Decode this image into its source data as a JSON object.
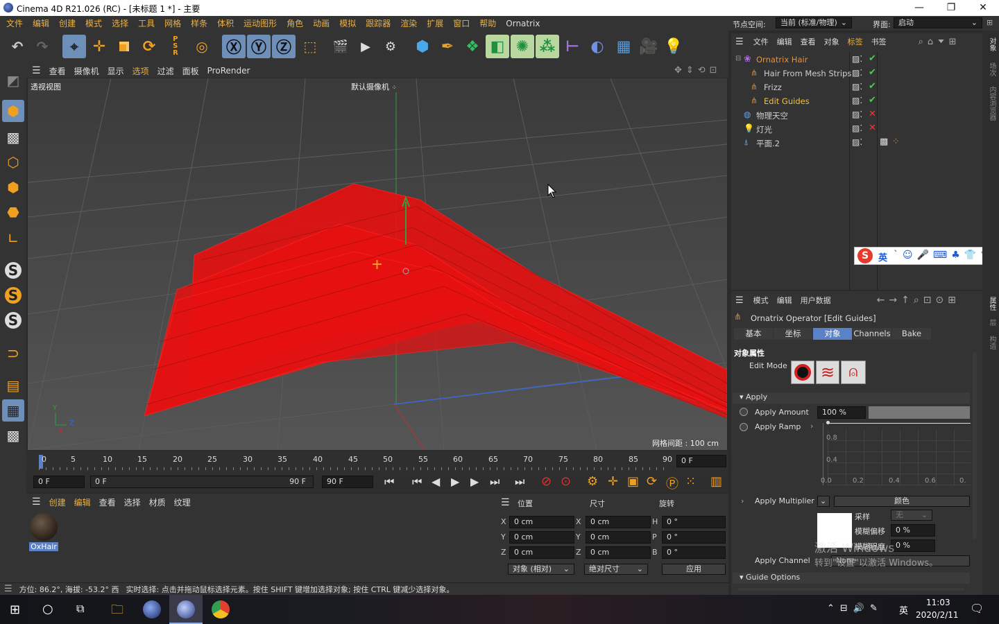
{
  "window": {
    "title": "Cinema 4D R21.026 (RC) - [未标题 1 *] - 主要",
    "min": "—",
    "max": "❐",
    "close": "✕"
  },
  "menubar": [
    "文件",
    "编辑",
    "创建",
    "模式",
    "选择",
    "工具",
    "网格",
    "样条",
    "体积",
    "运动图形",
    "角色",
    "动画",
    "模拟",
    "跟踪器",
    "渲染",
    "扩展",
    "窗口",
    "帮助",
    "Ornatrix"
  ],
  "nodebar": {
    "label": "节点空间:",
    "value": "当前 (标准/物理)",
    "layout_label": "界面:",
    "layout_value": "启动"
  },
  "viewport": {
    "menu": [
      "查看",
      "摄像机",
      "显示",
      "选项",
      "过滤",
      "面板",
      "ProRender"
    ],
    "view_name": "透视视图",
    "camera": "默认摄像机",
    "grid_info": "网格间距 : 100 cm",
    "axis_y": "Y",
    "axis_z": "Z",
    "axis_x": "X"
  },
  "timeline": {
    "ticks": [
      "0",
      "5",
      "10",
      "15",
      "20",
      "25",
      "30",
      "35",
      "40",
      "45",
      "50",
      "55",
      "60",
      "65",
      "70",
      "75",
      "80",
      "85",
      "90"
    ],
    "current_frame": "0 F",
    "start": "0 F",
    "range_start": "0 F",
    "range_end": "90 F",
    "end": "90 F"
  },
  "material_manager": {
    "menu": [
      "创建",
      "编辑",
      "查看",
      "选择",
      "材质",
      "纹理"
    ],
    "material_name": "OxHair"
  },
  "coordinates": {
    "headers": [
      "位置",
      "尺寸",
      "旋转"
    ],
    "rows": [
      {
        "a": "X",
        "av": "0 cm",
        "b": "X",
        "bv": "0 cm",
        "c": "H",
        "cv": "0 °"
      },
      {
        "a": "Y",
        "av": "0 cm",
        "b": "Y",
        "bv": "0 cm",
        "c": "P",
        "cv": "0 °"
      },
      {
        "a": "Z",
        "av": "0 cm",
        "b": "Z",
        "bv": "0 cm",
        "c": "B",
        "cv": "0 °"
      }
    ],
    "mode": "对象 (相对)",
    "size_mode": "绝对尺寸",
    "apply": "应用"
  },
  "status": {
    "angle": "方位: 86.2°, 海拔: -53.2° 西",
    "hint": "实时选择: 点击并拖动鼠标选择元素。按住 SHIFT 键增加选择对象; 按住 CTRL 键减少选择对象。"
  },
  "object_manager": {
    "menu": [
      "文件",
      "编辑",
      "查看",
      "对象",
      "标签",
      "书签"
    ],
    "objects": [
      {
        "name": "Ornatrix Hair",
        "color": "#e8903a",
        "indent": 0
      },
      {
        "name": "Hair From Mesh Strips",
        "color": "#d0d0d0",
        "indent": 2
      },
      {
        "name": "Frizz",
        "color": "#d0d0d0",
        "indent": 2
      },
      {
        "name": "Edit Guides",
        "color": "#f0c040",
        "indent": 2
      },
      {
        "name": "物理天空",
        "color": "#d0d0d0",
        "indent": 0
      },
      {
        "name": "灯光",
        "color": "#d0d0d0",
        "indent": 0
      },
      {
        "name": "平面.2",
        "color": "#d0d0d0",
        "indent": 0
      }
    ]
  },
  "ime": {
    "lang": "英"
  },
  "attributes": {
    "menu": [
      "模式",
      "编辑",
      "用户数据"
    ],
    "title": "Ornatrix Operator [Edit Guides]",
    "tabs": [
      "基本",
      "坐标",
      "对象",
      "Channels",
      "Bake"
    ],
    "active_tab": "对象",
    "section": "对象属性",
    "edit_mode": "Edit Mode",
    "apply_group": "Apply",
    "apply_amount_label": "Apply Amount",
    "apply_amount_value": "100 %",
    "apply_amount": 1.0,
    "apply_ramp_label": "Apply Ramp",
    "ramp_y": [
      "0.8",
      "0.4"
    ],
    "ramp_x": [
      "0.0",
      "0.2",
      "0.4",
      "0.6",
      "0."
    ],
    "apply_multiplier_label": "Apply Multiplier",
    "multiplier_color_label": "颜色",
    "sample_label": "采样",
    "sample_value": "无",
    "blur_offset_label": "模糊偏移",
    "blur_offset_value": "0 %",
    "blur_scale_label": "模糊程度",
    "blur_scale_value": "0 %",
    "apply_channel_label": "Apply Channel",
    "apply_channel_value": "None",
    "guide_options": "Guide Options",
    "watermark1": "激活 Windows",
    "watermark2": "转到\"设置\"以激活 Windows。"
  },
  "right_strip": [
    "对象",
    "场次",
    "内容浏览器",
    "属性",
    "层",
    "构造"
  ],
  "taskbar": {
    "time": "11:03",
    "date": "2020/2/11",
    "lang": "英"
  }
}
